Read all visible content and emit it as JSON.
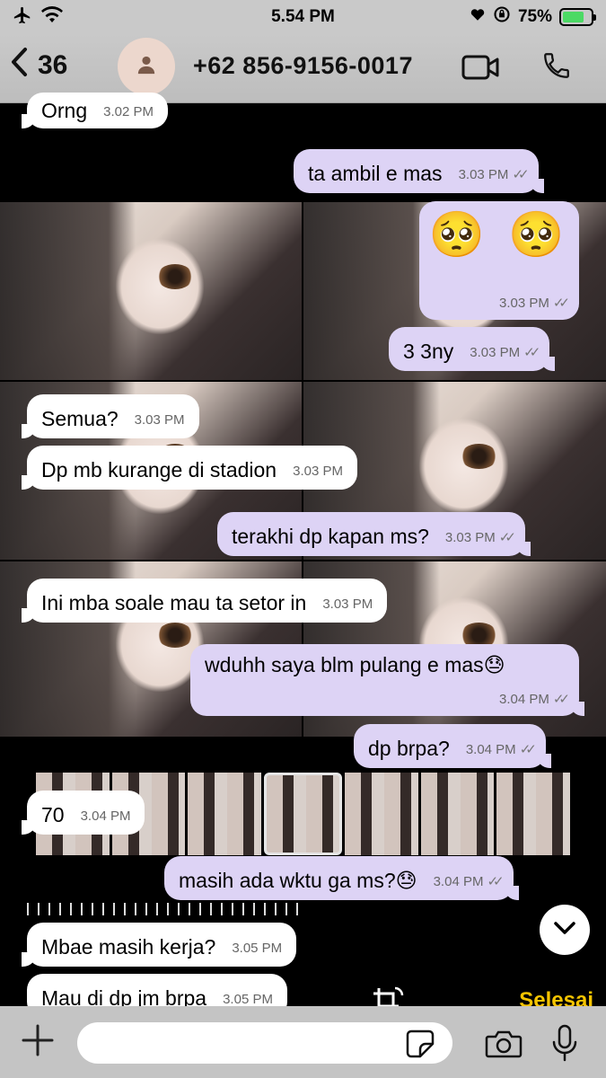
{
  "status": {
    "time": "5.54 PM",
    "battery": "75%",
    "battery_level": 0.75
  },
  "header": {
    "back_count": "36",
    "contact": "+62 856-9156-0017"
  },
  "messages": [
    {
      "dir": "in",
      "text": "Orng",
      "time": "3.02 PM"
    },
    {
      "dir": "out",
      "text": "ta ambil e mas",
      "time": "3.03 PM"
    },
    {
      "dir": "out",
      "text": "🥺 🥺",
      "time": "3.03 PM"
    },
    {
      "dir": "out",
      "text": "3 3ny",
      "time": "3.03 PM"
    },
    {
      "dir": "in",
      "text": "Semua?",
      "time": "3.03 PM"
    },
    {
      "dir": "in",
      "text": "Dp mb kurange di stadion",
      "time": "3.03 PM"
    },
    {
      "dir": "out",
      "text": "terakhi dp kapan ms?",
      "time": "3.03 PM"
    },
    {
      "dir": "in",
      "text": "Ini mba soale mau ta setor in",
      "time": "3.03 PM"
    },
    {
      "dir": "out",
      "text": "wduhh saya blm pulang e mas😓",
      "time": "3.04 PM"
    },
    {
      "dir": "out",
      "text": "dp brpa?",
      "time": "3.04 PM"
    },
    {
      "dir": "in",
      "text": "70",
      "time": "3.04 PM"
    },
    {
      "dir": "out",
      "text": "masih ada wktu ga ms?😓",
      "time": "3.04 PM"
    },
    {
      "dir": "in",
      "text": "Mbae masih kerja?",
      "time": "3.05 PM"
    },
    {
      "dir": "in",
      "text": "Mau di dp jm brpa",
      "time": "3.05 PM"
    }
  ],
  "editor": {
    "done_label": "Selesai"
  },
  "input": {
    "placeholder": ""
  },
  "colors": {
    "outgoing": "#ddd3f5",
    "incoming": "#ffffff",
    "accent": "#f5c400"
  },
  "icons": [
    "airplane-icon",
    "wifi-icon",
    "heart-icon",
    "rotation-lock-icon",
    "battery-icon",
    "back-chevron-icon",
    "person-icon",
    "video-call-icon",
    "phone-icon",
    "crop-rotate-icon",
    "chevron-down-icon",
    "plus-icon",
    "sticker-icon",
    "camera-icon",
    "microphone-icon"
  ]
}
